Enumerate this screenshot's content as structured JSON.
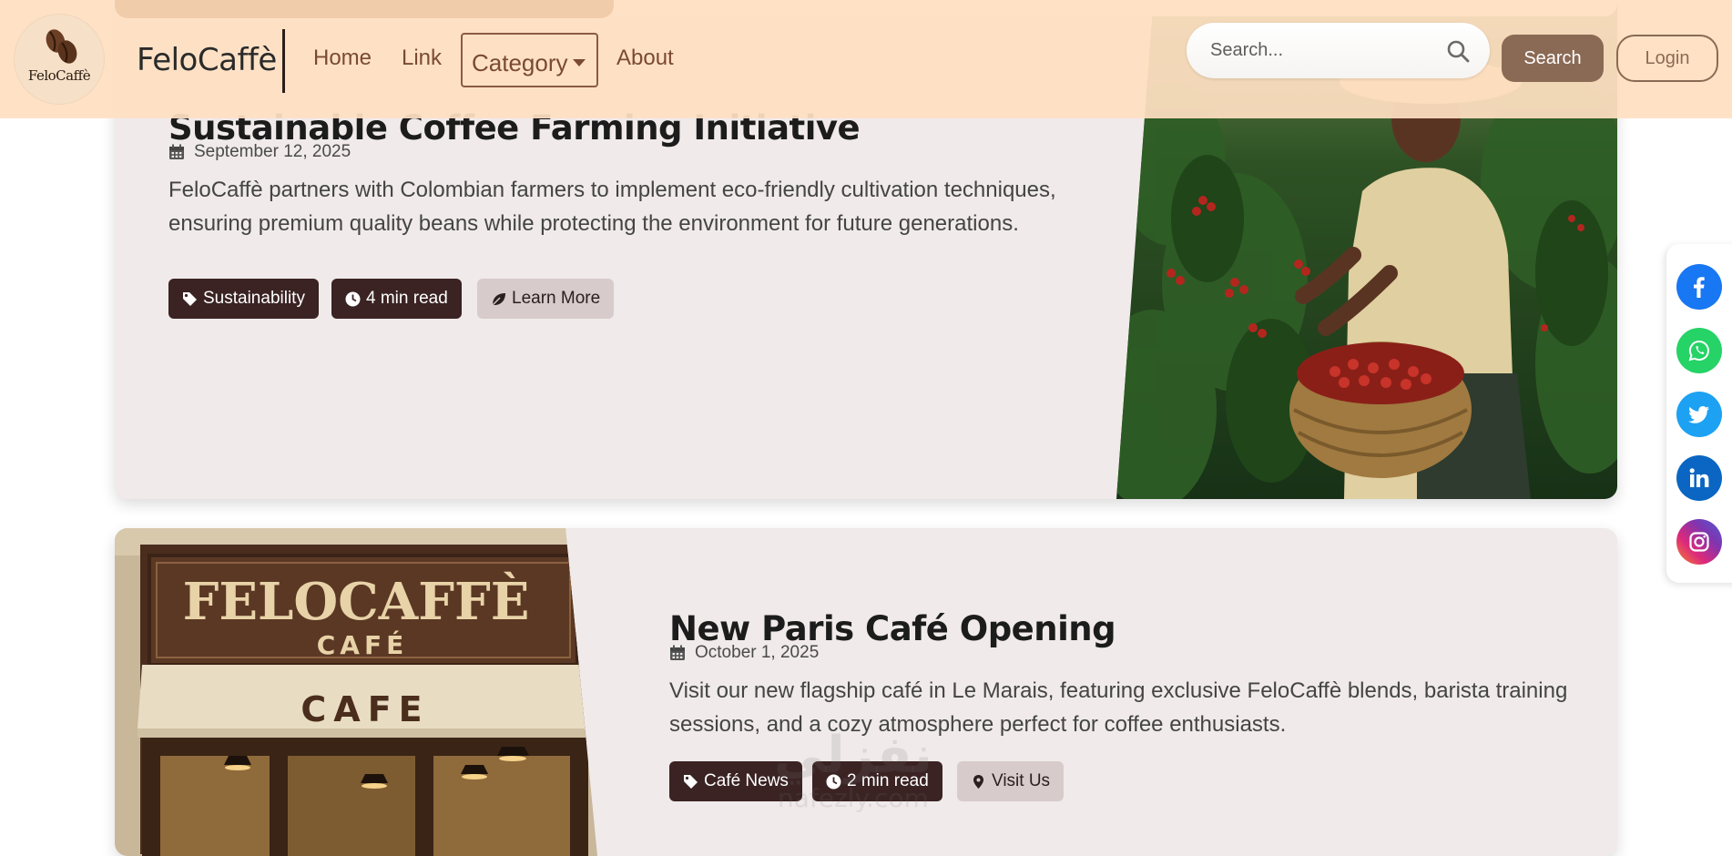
{
  "navbar": {
    "logo_text": "FeloCaffè",
    "brand": "FeloCaffè",
    "links": {
      "home": "Home",
      "link": "Link",
      "category": "Category",
      "about": "About"
    },
    "search": {
      "placeholder": "Search...",
      "button_label": "Search"
    },
    "login_label": "Login"
  },
  "articles": [
    {
      "title": "Sustainable Coffee Farming Initiative",
      "date": "September 12, 2025",
      "description_line1": "FeloCaffè partners with Colombian farmers to implement eco-friendly cultivation techniques,",
      "description_line2": "ensuring premium quality beans while protecting the environment for future generations.",
      "badges": {
        "category": "Sustainability",
        "read_time": "4 min read",
        "action": "Learn More"
      }
    },
    {
      "title": "New Paris Café Opening",
      "date": "October 1, 2025",
      "description_line1": "Visit our new flagship café in Le Marais, featuring exclusive FeloCaffè blends, barista training",
      "description_line2": "sessions, and a cozy atmosphere perfect for coffee enthusiasts.",
      "badges": {
        "category": "Café News",
        "read_time": "2 min read",
        "action": "Visit Us"
      },
      "storefront": {
        "sign_main": "FELOCAFFÈ",
        "sign_sub": "CAFÉ",
        "awning": "CAFE"
      }
    }
  ],
  "social": [
    {
      "name": "facebook-icon",
      "color": "#1877f2"
    },
    {
      "name": "whatsapp-icon",
      "color": "#25d366"
    },
    {
      "name": "twitter-icon",
      "color": "#1da1f2"
    },
    {
      "name": "linkedin-icon",
      "color": "#0a66c2"
    },
    {
      "name": "instagram-icon",
      "color": "#c13584"
    }
  ],
  "watermark": {
    "main": "نفزلي",
    "sub": "nafezly.com"
  }
}
